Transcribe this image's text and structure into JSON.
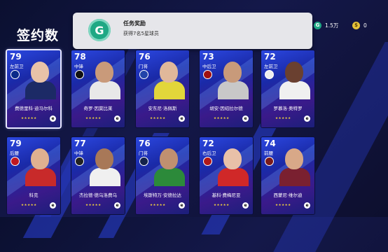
{
  "screen": {
    "title": "签约数"
  },
  "toast": {
    "icon": "G",
    "title": "任务奖励",
    "message": "获得7名5星球员"
  },
  "currency": [
    {
      "icon": "G",
      "icon_name": "gp-coin-icon",
      "color": "#1fa884",
      "value": "1.5万"
    },
    {
      "icon": "$",
      "icon_name": "ecoin-icon",
      "color": "#e6c23a",
      "value": "0"
    }
  ],
  "cards": [
    {
      "rating": "79",
      "position": "左前卫",
      "name": "费德里科·迪马尔科",
      "stars": "★★★★★",
      "club_icon": "inter-icon",
      "club_color": "#0a2a8a",
      "skin": "#e8c2a8",
      "kit": "#1c2a66",
      "selected": true
    },
    {
      "rating": "78",
      "position": "中锋",
      "name": "奇罗·因莫比莱",
      "stars": "★★★★★",
      "club_icon": "besiktas-icon",
      "club_color": "#111111",
      "skin": "#c99a7a",
      "kit": "#e8e8e8",
      "selected": false
    },
    {
      "rating": "76",
      "position": "门将",
      "name": "安东尼·洛佩斯",
      "stars": "★★★★★",
      "club_icon": "lyon-icon",
      "club_color": "#2244aa",
      "skin": "#e0b89a",
      "kit": "#e2d63a",
      "selected": false
    },
    {
      "rating": "73",
      "position": "中后卫",
      "name": "胡安·因绍拉尔德",
      "stars": "★★★★★",
      "club_icon": "braga-icon",
      "club_color": "#a01010",
      "skin": "#c89a7a",
      "kit": "#c8c8c8",
      "selected": false
    },
    {
      "rating": "72",
      "position": "左前卫",
      "name": "罗慕洛·奥特罗",
      "stars": "★★★★★",
      "club_icon": "santos-icon",
      "club_color": "#eeeeee",
      "skin": "#6a4030",
      "kit": "#f0f0f0",
      "selected": false
    },
    {
      "rating": "79",
      "position": "后腰",
      "name": "科克",
      "stars": "★★★★★",
      "club_icon": "atletico-icon",
      "club_color": "#c01820",
      "skin": "#e0b090",
      "kit": "#c82a2a",
      "selected": false
    },
    {
      "rating": "77",
      "position": "中锋",
      "name": "杰拉德·德乌洛费乌",
      "stars": "★★★★★",
      "club_icon": "udinese-icon",
      "club_color": "#222222",
      "skin": "#a87858",
      "kit": "#f0f0f0",
      "selected": false
    },
    {
      "rating": "76",
      "position": "门将",
      "name": "埃斯特万·安德拉达",
      "stars": "★★★★★",
      "club_icon": "monterrey-icon",
      "club_color": "#14224a",
      "skin": "#c09070",
      "kit": "#2c8a3a",
      "selected": false
    },
    {
      "rating": "72",
      "position": "右后卫",
      "name": "基科·费梅尼亚",
      "stars": "★★★★★",
      "club_icon": "mallorca-icon",
      "club_color": "#b01818",
      "skin": "#e8c0a8",
      "kit": "#d02828",
      "selected": false
    },
    {
      "rating": "74",
      "position": "前腰",
      "name": "西蒙尼·维尔迪",
      "stars": "★★★★★",
      "club_icon": "torino-icon",
      "club_color": "#7a1a1a",
      "skin": "#d8a888",
      "kit": "#7a2030",
      "selected": false
    }
  ]
}
